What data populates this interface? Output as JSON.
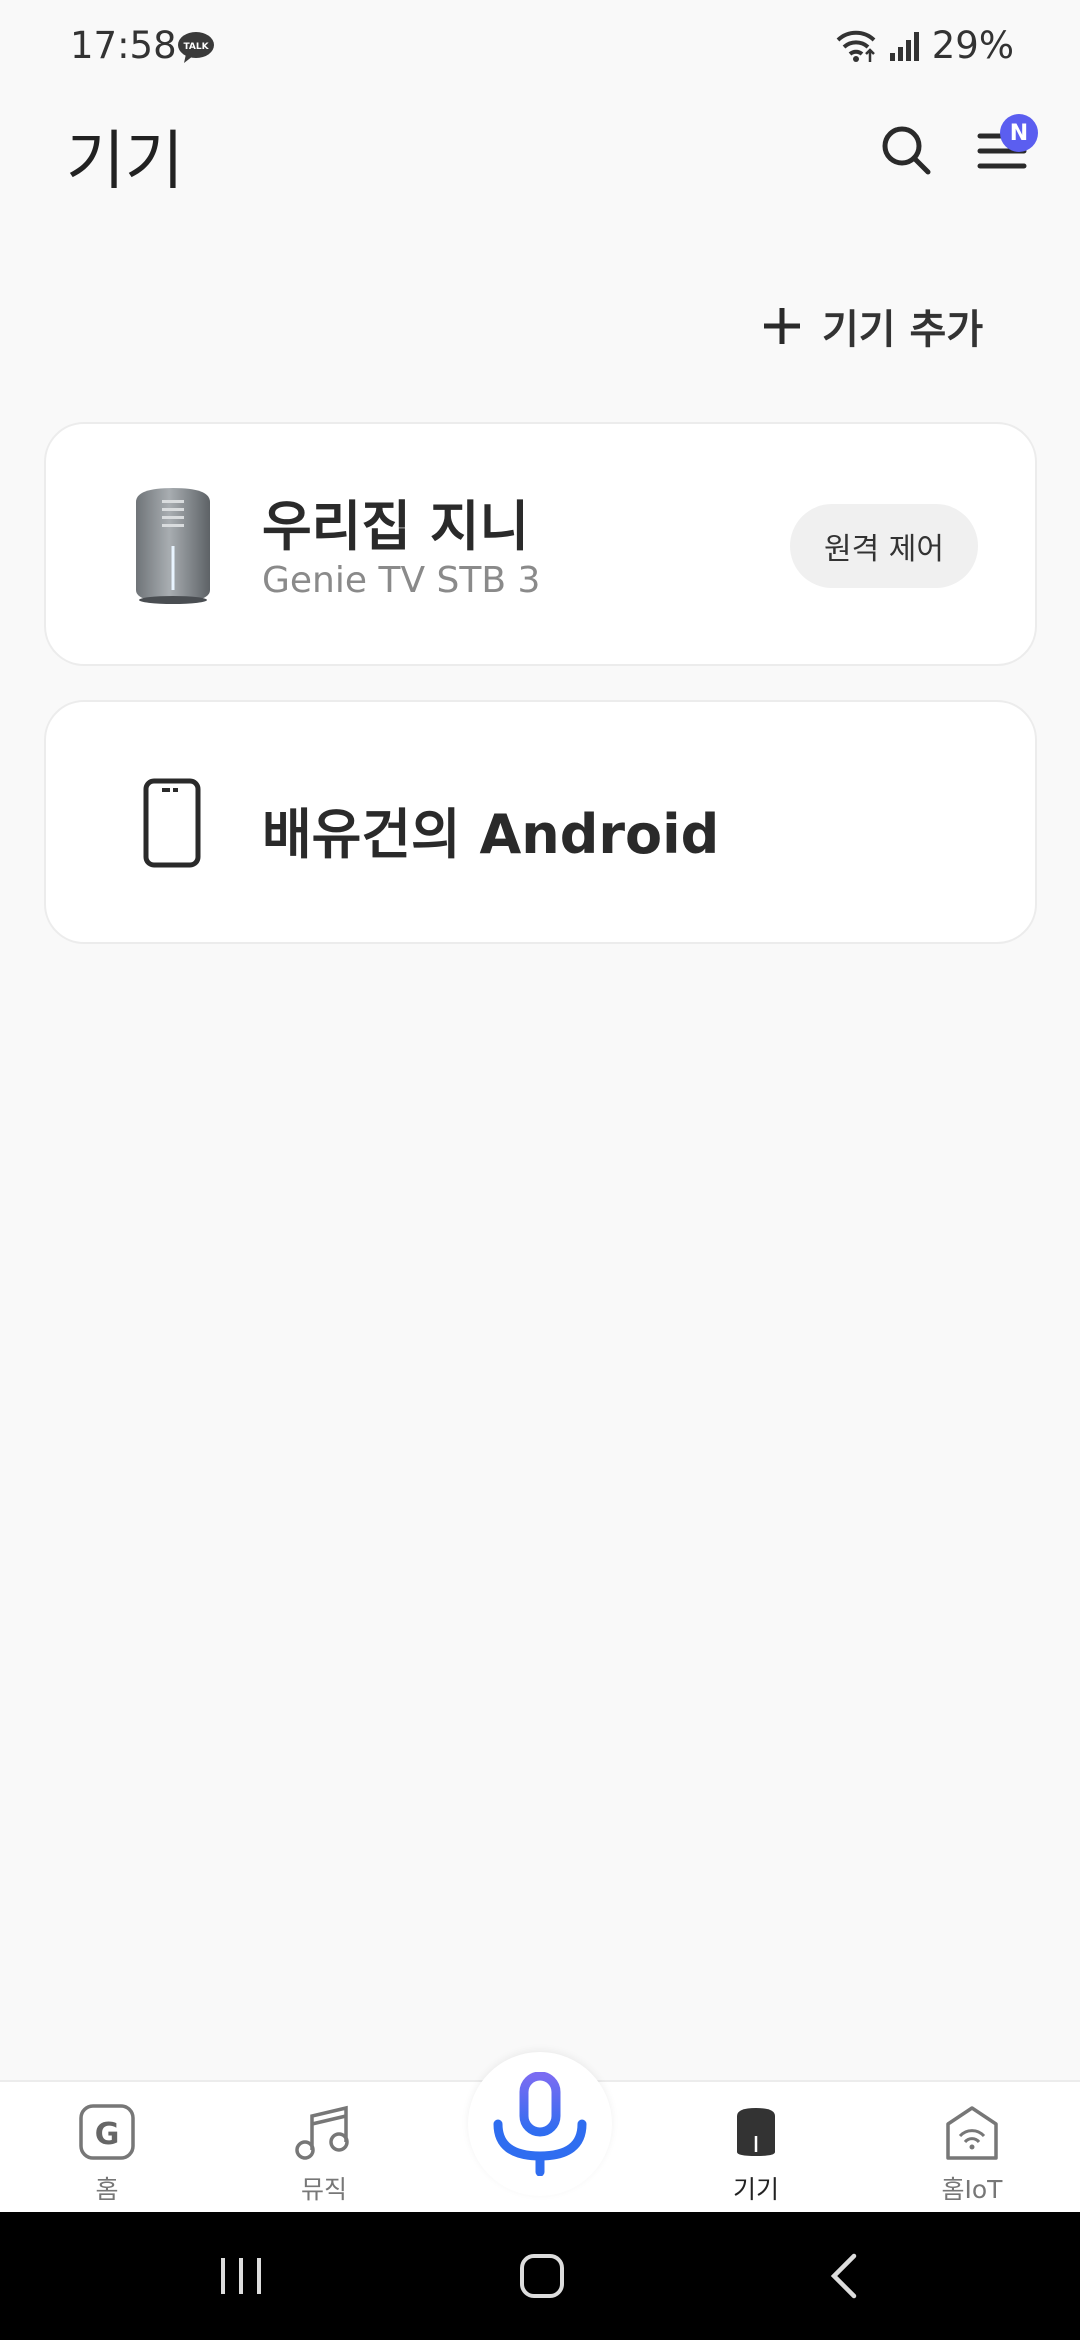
{
  "status_bar": {
    "time": "17:58",
    "talk_badge": "TALK",
    "battery": "29%"
  },
  "header": {
    "title": "기기",
    "menu_badge": "N"
  },
  "actions": {
    "add_device_label": "기기 추가"
  },
  "devices": [
    {
      "name": "우리집 지니",
      "model": "Genie TV STB 3",
      "remote_label": "원격 제어",
      "icon": "speaker-icon"
    },
    {
      "name": "배유건의 Android",
      "icon": "phone-icon"
    }
  ],
  "bottom_nav": {
    "items": [
      {
        "label": "홈",
        "icon": "g-home-icon",
        "active": false
      },
      {
        "label": "뮤직",
        "icon": "music-note-icon",
        "active": false
      },
      {
        "label": "기기",
        "icon": "device-icon",
        "active": true
      },
      {
        "label": "홈IoT",
        "icon": "home-iot-icon",
        "active": false
      }
    ],
    "mic_icon": "mic-icon"
  },
  "colors": {
    "accent": "#5b5ef0",
    "mic_gradient_start": "#7a6cf2",
    "mic_gradient_end": "#2f6df0"
  }
}
